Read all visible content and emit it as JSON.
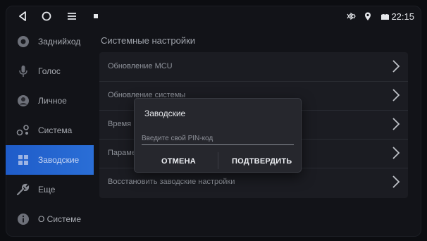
{
  "status_bar": {
    "time": "22:15",
    "icons": [
      "back-icon",
      "home-icon",
      "menu-icon",
      "notification-icon",
      "bluetooth-icon",
      "location-icon",
      "signal-icon"
    ]
  },
  "sidebar": {
    "items": [
      {
        "label": "Заднийход",
        "icon": "camera-icon"
      },
      {
        "label": "Голос",
        "icon": "microphone-icon"
      },
      {
        "label": "Личное",
        "icon": "user-icon"
      },
      {
        "label": "Система",
        "icon": "system-settings-icon"
      },
      {
        "label": "Заводские",
        "icon": "factory-icon",
        "active": true
      },
      {
        "label": "Еще",
        "icon": "wrench-icon"
      },
      {
        "label": "О Системе",
        "icon": "info-icon"
      }
    ]
  },
  "main": {
    "title": "Системные настройки",
    "rows": [
      {
        "label": "Обновление MCU"
      },
      {
        "label": "Обновление системы"
      },
      {
        "label": "Время"
      },
      {
        "label": "Параметры"
      },
      {
        "label": "Восстановить заводские настройки"
      }
    ]
  },
  "dialog": {
    "title": "Заводские",
    "pin_placeholder": "Введите свой PIN-код",
    "cancel_label": "ОТМЕНА",
    "confirm_label": "ПОДТВЕРДИТЬ"
  },
  "colors": {
    "accent": "#2a6ed6",
    "background": "#121318",
    "panel": "#1b1c22",
    "dialog": "#26272d"
  }
}
